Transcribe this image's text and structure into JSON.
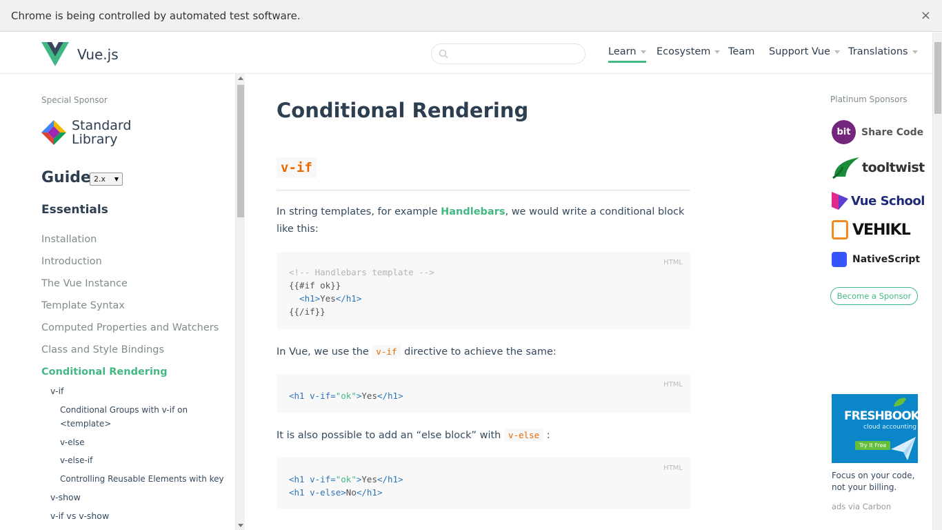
{
  "infobar": {
    "message": "Chrome is being controlled by automated test software.",
    "close": "×"
  },
  "header": {
    "brand": "Vue.js",
    "search_placeholder": "",
    "nav": [
      {
        "label": "Learn",
        "dropdown": true,
        "active": true
      },
      {
        "label": "Ecosystem",
        "dropdown": true
      },
      {
        "label": "Team",
        "dropdown": false
      },
      {
        "label": "Support Vue",
        "dropdown": true
      },
      {
        "label": "Translations",
        "dropdown": true
      }
    ]
  },
  "sidebar": {
    "special_sponsor_label": "Special Sponsor",
    "special_sponsor_line1": "Standard",
    "special_sponsor_line2": "Library",
    "guide_title": "Guide",
    "version": "2.x",
    "section_title": "Essentials",
    "items": [
      "Installation",
      "Introduction",
      "The Vue Instance",
      "Template Syntax",
      "Computed Properties and Watchers",
      "Class and Style Bindings",
      "Conditional Rendering"
    ],
    "sub_items": {
      "v_if": "v-if",
      "groups": "Conditional Groups with v-if on <template>",
      "v_else": "v-else",
      "v_else_if": "v-else-if",
      "reusable": "Controlling Reusable Elements with key",
      "v_show": "v-show",
      "v_if_vs_v_show": "v-if vs v-show"
    }
  },
  "main": {
    "title": "Conditional Rendering",
    "h2": "v-if",
    "p1_before": "In string templates, for example ",
    "p1_link": "Handlebars",
    "p1_after": ", we would write a conditional block like this:",
    "code1": {
      "lang": "HTML",
      "l1": "<!-- Handlebars template -->",
      "l2": "{{#if ok}}",
      "l3_open": "  <h1>",
      "l3_text": "Yes",
      "l3_close": "</h1>",
      "l4": "{{/if}}"
    },
    "p2_before": "In Vue, we use the ",
    "p2_code": "v-if",
    "p2_after": " directive to achieve the same:",
    "code2": {
      "lang": "HTML",
      "tag_open": "<h1 ",
      "attr": "v-if=",
      "str": "\"ok\"",
      "gt": ">",
      "text": "Yes",
      "close": "</h1>"
    },
    "p3_before": "It is also possible to add an “else block” with ",
    "p3_code": "v-else",
    "p3_after": " :",
    "code3": {
      "lang": "HTML",
      "l1_tag": "<h1 ",
      "l1_attr": "v-if=",
      "l1_str": "\"ok\"",
      "l1_gt": ">",
      "l1_text": "Yes",
      "l1_close": "</h1>",
      "l2_tag": "<h1 ",
      "l2_attr": "v-else",
      "l2_gt": ">",
      "l2_text": "No",
      "l2_close": "</h1>"
    }
  },
  "right": {
    "platinum_label": "Platinum Sponsors",
    "sponsors": [
      "Share Code",
      "tooltwist",
      "Vue School",
      "VEHIKL",
      "NativeScript"
    ],
    "bit_label": "bit",
    "become_sponsor": "Become a Sponsor",
    "ad_brand": "FRESHBOOKS",
    "ad_sub": "cloud accounting",
    "ad_cta": "Try It Free",
    "ad_text": "Focus on your code, not your billing.",
    "ad_by": "ads via Carbon"
  },
  "colors": {
    "accent": "#42b983",
    "code_orange": "#e96900",
    "text": "#34495e"
  }
}
